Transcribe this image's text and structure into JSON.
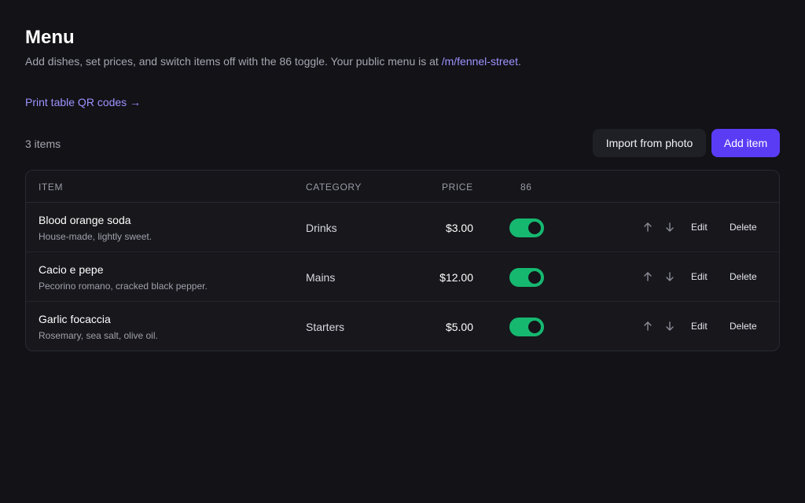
{
  "header": {
    "title": "Menu",
    "subtitle_text": "Add dishes, set prices, and switch items off with the 86 toggle. Your public menu is at ",
    "public_link": "/m/fennel-street",
    "subtitle_end": ".",
    "qr_link": "Print table QR codes →"
  },
  "toolbar": {
    "count": "3 items",
    "import_label": "Import from photo",
    "add_label": "Add item"
  },
  "table": {
    "columns": {
      "item": "ITEM",
      "category": "CATEGORY",
      "price": "PRICE",
      "eighty_six": "86"
    },
    "actions": {
      "edit": "Edit",
      "delete": "Delete"
    },
    "rows": [
      {
        "name": "Blood orange soda",
        "description": "House-made, lightly sweet.",
        "category": "Drinks",
        "price": "$3.00",
        "on": true
      },
      {
        "name": "Cacio e pepe",
        "description": "Pecorino romano, cracked black pepper.",
        "category": "Mains",
        "price": "$12.00",
        "on": true
      },
      {
        "name": "Garlic focaccia",
        "description": "Rosemary, sea salt, olive oil.",
        "category": "Starters",
        "price": "$5.00",
        "on": true
      }
    ]
  },
  "colors": {
    "accent": "#5b3cf5",
    "link": "#9d93ff",
    "toggle_on": "#16b870",
    "background": "#121217"
  }
}
